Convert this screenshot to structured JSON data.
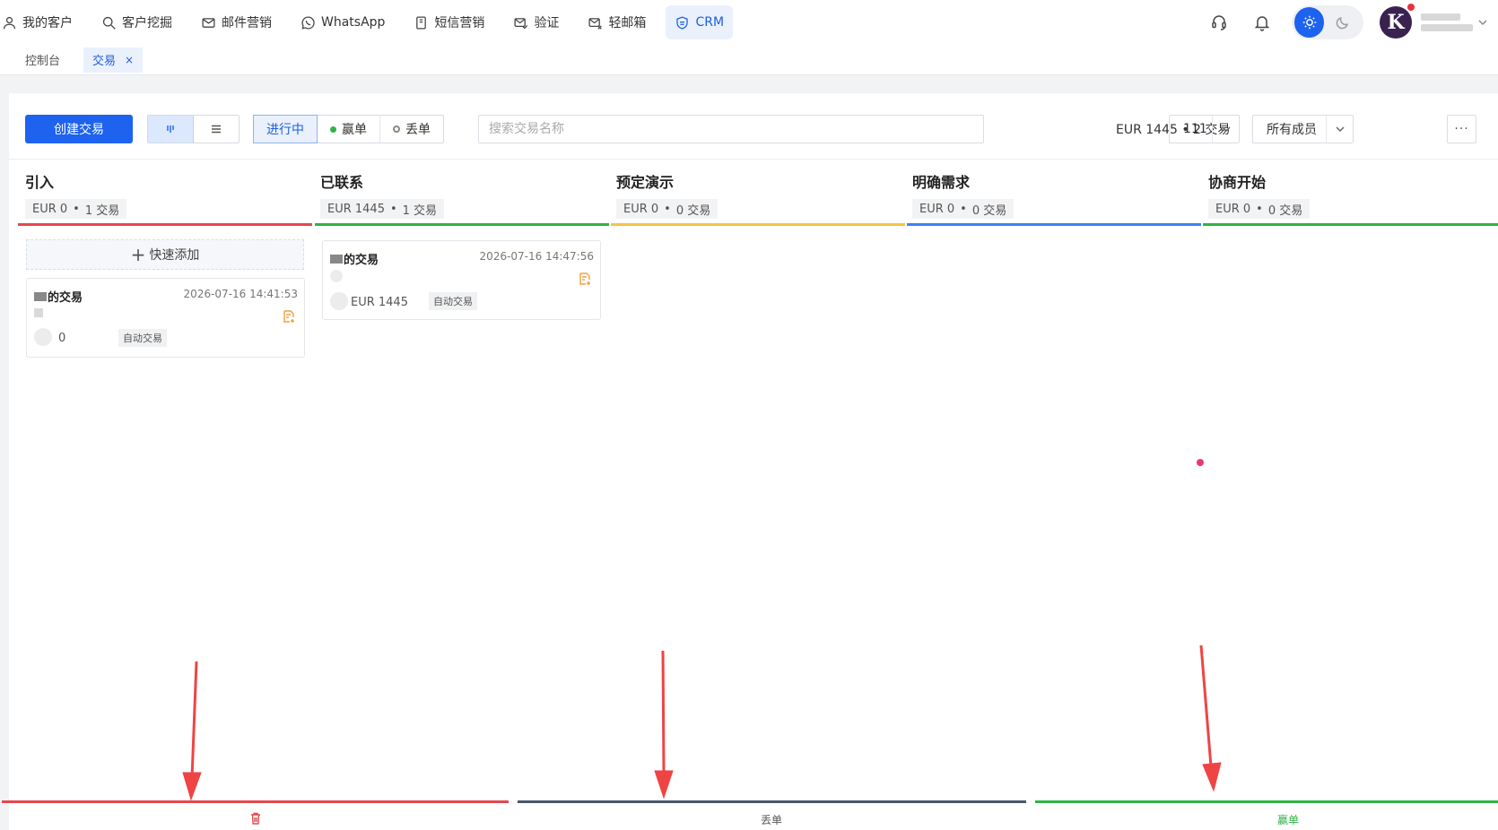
{
  "nav": {
    "items": [
      {
        "label": "我的客户",
        "icon": "user-icon"
      },
      {
        "label": "客户挖掘",
        "icon": "search-icon"
      },
      {
        "label": "邮件营销",
        "icon": "mail-icon"
      },
      {
        "label": "WhatsApp",
        "icon": "whatsapp-icon"
      },
      {
        "label": "短信营销",
        "icon": "sms-icon"
      },
      {
        "label": "验证",
        "icon": "mail-check-icon"
      },
      {
        "label": "轻邮箱",
        "icon": "mail-light-icon"
      },
      {
        "label": "CRM",
        "icon": "crm-shield-icon",
        "active": true
      }
    ],
    "avatar_letter": "K"
  },
  "tabs": {
    "dashboard": "控制台",
    "deals": "交易",
    "close": "×"
  },
  "toolbar": {
    "create_label": "创建交易",
    "status_in_progress": "进行中",
    "status_won": "赢单",
    "status_lost": "丢单",
    "search_placeholder": "搜索交易名称",
    "summary": "EUR 1445 • 2 交易",
    "pipeline_value": "111",
    "members_value": "所有成员",
    "more_label": "···"
  },
  "stages": [
    {
      "title": "引入",
      "amount": "EUR 0",
      "count": "1 交易",
      "color": "#e5484d"
    },
    {
      "title": "已联系",
      "amount": "EUR 1445",
      "count": "1 交易",
      "color": "#2fb344"
    },
    {
      "title": "预定演示",
      "amount": "EUR 0",
      "count": "0 交易",
      "color": "#f5c443"
    },
    {
      "title": "明确需求",
      "amount": "EUR 0",
      "count": "0 交易",
      "color": "#3b82f6"
    },
    {
      "title": "协商开始",
      "amount": "EUR 0",
      "count": "0 交易",
      "color": "#2fb344"
    }
  ],
  "quick_add": "快速添加",
  "cards": [
    {
      "name": "的交易",
      "time": "2026-07-16 14:41:53",
      "amount": "0",
      "tag": "自动交易"
    },
    {
      "name": "的交易",
      "time": "2026-07-16 14:47:56",
      "amount": "EUR 1445",
      "tag": "自动交易"
    }
  ],
  "drop_zones": {
    "delete_color": "#e5484d",
    "lost_label": "丢单",
    "lost_color": "#4a5568",
    "won_label": "赢单",
    "won_color": "#2fb344"
  },
  "colors": {
    "accent": "#1e63f0",
    "annotation_arrow": "#ef4444"
  }
}
